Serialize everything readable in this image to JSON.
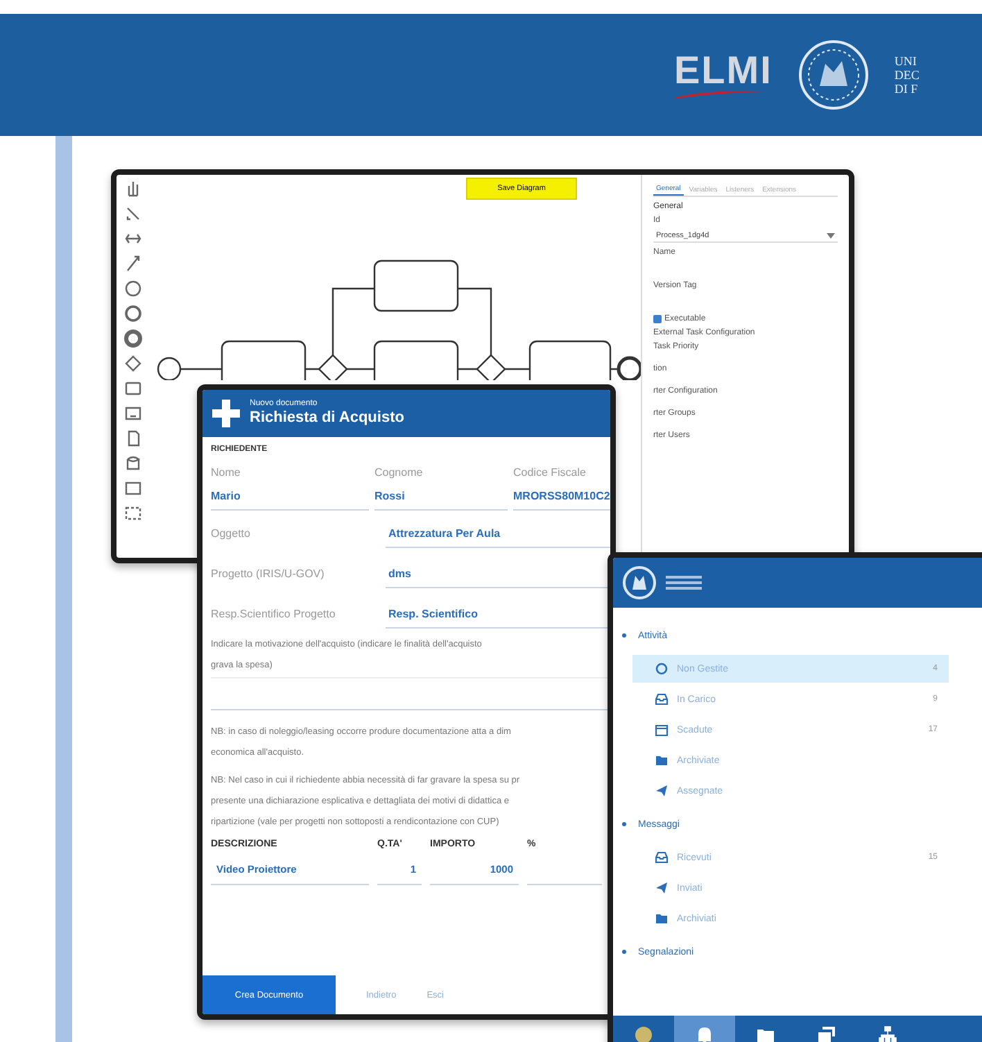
{
  "header": {
    "brand": "ELMI",
    "institution_lines": [
      "UNI",
      "DEC",
      "DI F"
    ]
  },
  "diagram_editor": {
    "save_button": "Save Diagram",
    "tools": [
      {
        "kind": "hand"
      },
      {
        "kind": "lasso"
      },
      {
        "kind": "space"
      },
      {
        "kind": "connect"
      },
      {
        "kind": "start"
      },
      {
        "kind": "intermediate"
      },
      {
        "kind": "end"
      },
      {
        "kind": "gateway"
      },
      {
        "kind": "task"
      },
      {
        "kind": "subprocess"
      },
      {
        "kind": "data"
      },
      {
        "kind": "store"
      },
      {
        "kind": "pool"
      },
      {
        "kind": "group"
      }
    ],
    "properties": {
      "tabs": [
        {
          "label": "General",
          "selected": true
        },
        {
          "label": "Variables",
          "selected": false
        },
        {
          "label": "Listeners",
          "selected": false
        },
        {
          "label": "Extensions",
          "selected": false
        }
      ],
      "section": "General",
      "id_label": "Id",
      "id_value": "Process_1dg4d",
      "name_label": "Name",
      "version_label": "Version Tag",
      "executable": {
        "label": "Executable",
        "checked": true
      },
      "external_label": "External Task Configuration",
      "priority_label": "Task Priority",
      "hidden_lines": [
        "tion",
        "rter Configuration",
        "rter Groups",
        "rter Users"
      ]
    }
  },
  "form": {
    "subtitle": "Nuovo documento",
    "title": "Richiesta di Acquisto",
    "section": "RICHIEDENTE",
    "person": [
      {
        "label": "Nome",
        "value": "Mario"
      },
      {
        "label": "Cognome",
        "value": "Rossi"
      },
      {
        "label": "Codice Fiscale",
        "value": "MRORSS80M10C2"
      }
    ],
    "rows": [
      {
        "label": "Oggetto",
        "value": "Attrezzatura Per Aula"
      },
      {
        "label": "Progetto (IRIS/U-GOV)",
        "value": "dms"
      },
      {
        "label": "Resp.Scientifico Progetto",
        "value": "Resp. Scientifico"
      }
    ],
    "motivation": [
      "Indicare la motivazione dell'acquisto (indicare le finalità dell'acquisto",
      "grava la spesa)"
    ],
    "notes": [
      [
        "NB: in caso di noleggio/leasing occorre produre documentazione atta a dim",
        "economica all'acquisto."
      ],
      [
        "NB: Nel caso in cui il richiedente abbia necessità di far gravare la spesa su pr",
        "presente una dichiarazione esplicativa e dettagliata dei motivi di didattica e",
        "ripartizione (vale per progetti non sottoposti a rendicontazione con CUP)"
      ]
    ],
    "table": {
      "columns": [
        "DESCRIZIONE",
        "Q.TA'",
        "IMPORTO",
        "%"
      ],
      "rows": [
        [
          "Video Proiettore",
          "1",
          "1000"
        ]
      ]
    },
    "buttons": [
      {
        "label": "Crea Documento",
        "kind": "primary"
      },
      {
        "label": "Indietro",
        "kind": "link"
      },
      {
        "label": "Esci",
        "kind": "link"
      }
    ]
  },
  "mobile": {
    "sections": [
      {
        "title": "Attività",
        "items": [
          {
            "label": "Non Gestite",
            "kind": "circle",
            "count": "4",
            "selected": true
          },
          {
            "label": "In Carico",
            "kind": "inbox",
            "count": "9",
            "selected": false
          },
          {
            "label": "Scadute",
            "kind": "calendar",
            "count": "17",
            "selected": false
          },
          {
            "label": "Archiviate",
            "kind": "folder",
            "selected": false
          },
          {
            "label": "Assegnate",
            "kind": "send",
            "selected": false
          }
        ]
      },
      {
        "title": "Messaggi",
        "items": [
          {
            "label": "Ricevuti",
            "kind": "inbox",
            "count": "15",
            "selected": false
          },
          {
            "label": "Inviati",
            "kind": "send",
            "selected": false
          },
          {
            "label": "Archiviati",
            "kind": "folder",
            "selected": false
          }
        ]
      },
      {
        "title": "Segnalazioni"
      }
    ],
    "nav": [
      {
        "kind": "emblem",
        "selected": false
      },
      {
        "kind": "bell",
        "selected": true
      },
      {
        "kind": "folder",
        "selected": false
      },
      {
        "kind": "messages",
        "selected": false
      },
      {
        "kind": "org-chart",
        "selected": false
      }
    ]
  }
}
